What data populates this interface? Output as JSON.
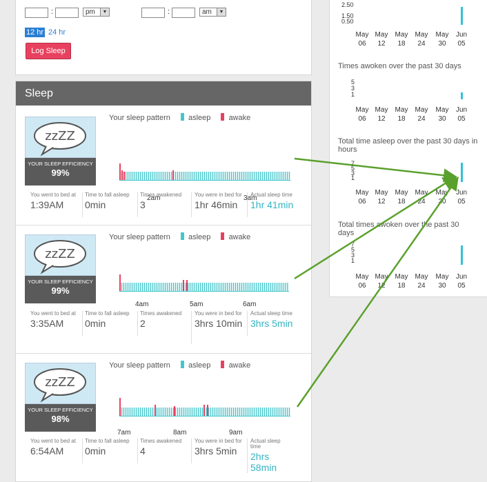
{
  "log_form": {
    "start_ampm": "pm",
    "end_ampm": "am",
    "colon": ":",
    "hr12": "12 hr",
    "hr24": "24 hr",
    "log_button": "Log Sleep"
  },
  "sleep": {
    "title": "Sleep",
    "pattern_label": "Your sleep pattern",
    "legend_asleep": "asleep",
    "legend_awake": "awake",
    "badge_label": "YOUR SLEEP EFFICIENCY",
    "badge_art": "zzZZ",
    "cap_bed": "You went to bed at",
    "cap_fall": "Time to fall asleep",
    "cap_awakened": "Times awakened",
    "cap_inbed": "You were in bed for",
    "cap_actual": "Actual sleep time",
    "entries": [
      {
        "efficiency": "99%",
        "hours": [
          "2am",
          "3am"
        ],
        "bed": "1:39AM",
        "fall": "0min",
        "awakened": "3",
        "inbed": "1hr 46min",
        "actual": "1hr 41min"
      },
      {
        "efficiency": "99%",
        "hours": [
          "4am",
          "5am",
          "6am"
        ],
        "bed": "3:35AM",
        "fall": "0min",
        "awakened": "2",
        "inbed": "3hrs 10min",
        "actual": "3hrs 5min"
      },
      {
        "efficiency": "98%",
        "hours": [
          "7am",
          "8am",
          "9am"
        ],
        "bed": "6:54AM",
        "fall": "0min",
        "awakened": "4",
        "inbed": "3hrs 5min",
        "actual": "2hrs 58min"
      }
    ]
  },
  "right": {
    "x_months": [
      "May",
      "May",
      "May",
      "May",
      "May",
      "Jun"
    ],
    "x_days": [
      "06",
      "12",
      "18",
      "24",
      "30",
      "05"
    ],
    "chart1_y": [
      "2.50",
      "1.50",
      "0.50"
    ],
    "chart2_title": "Times awoken over the past 30 days",
    "chart2_y": [
      "5",
      "3",
      "1"
    ],
    "chart3_title": "Total time asleep over the past 30 days in hours",
    "chart3_y": [
      "7",
      "5",
      "3",
      "1"
    ],
    "chart4_title": "Total times awoken over the past 30 days",
    "chart4_y": [
      "7",
      "5",
      "3",
      "1"
    ]
  },
  "colors": {
    "asleep": "#44c6cc",
    "awake": "#e8415f",
    "header": "#666666",
    "arrow": "#5aa02c"
  }
}
